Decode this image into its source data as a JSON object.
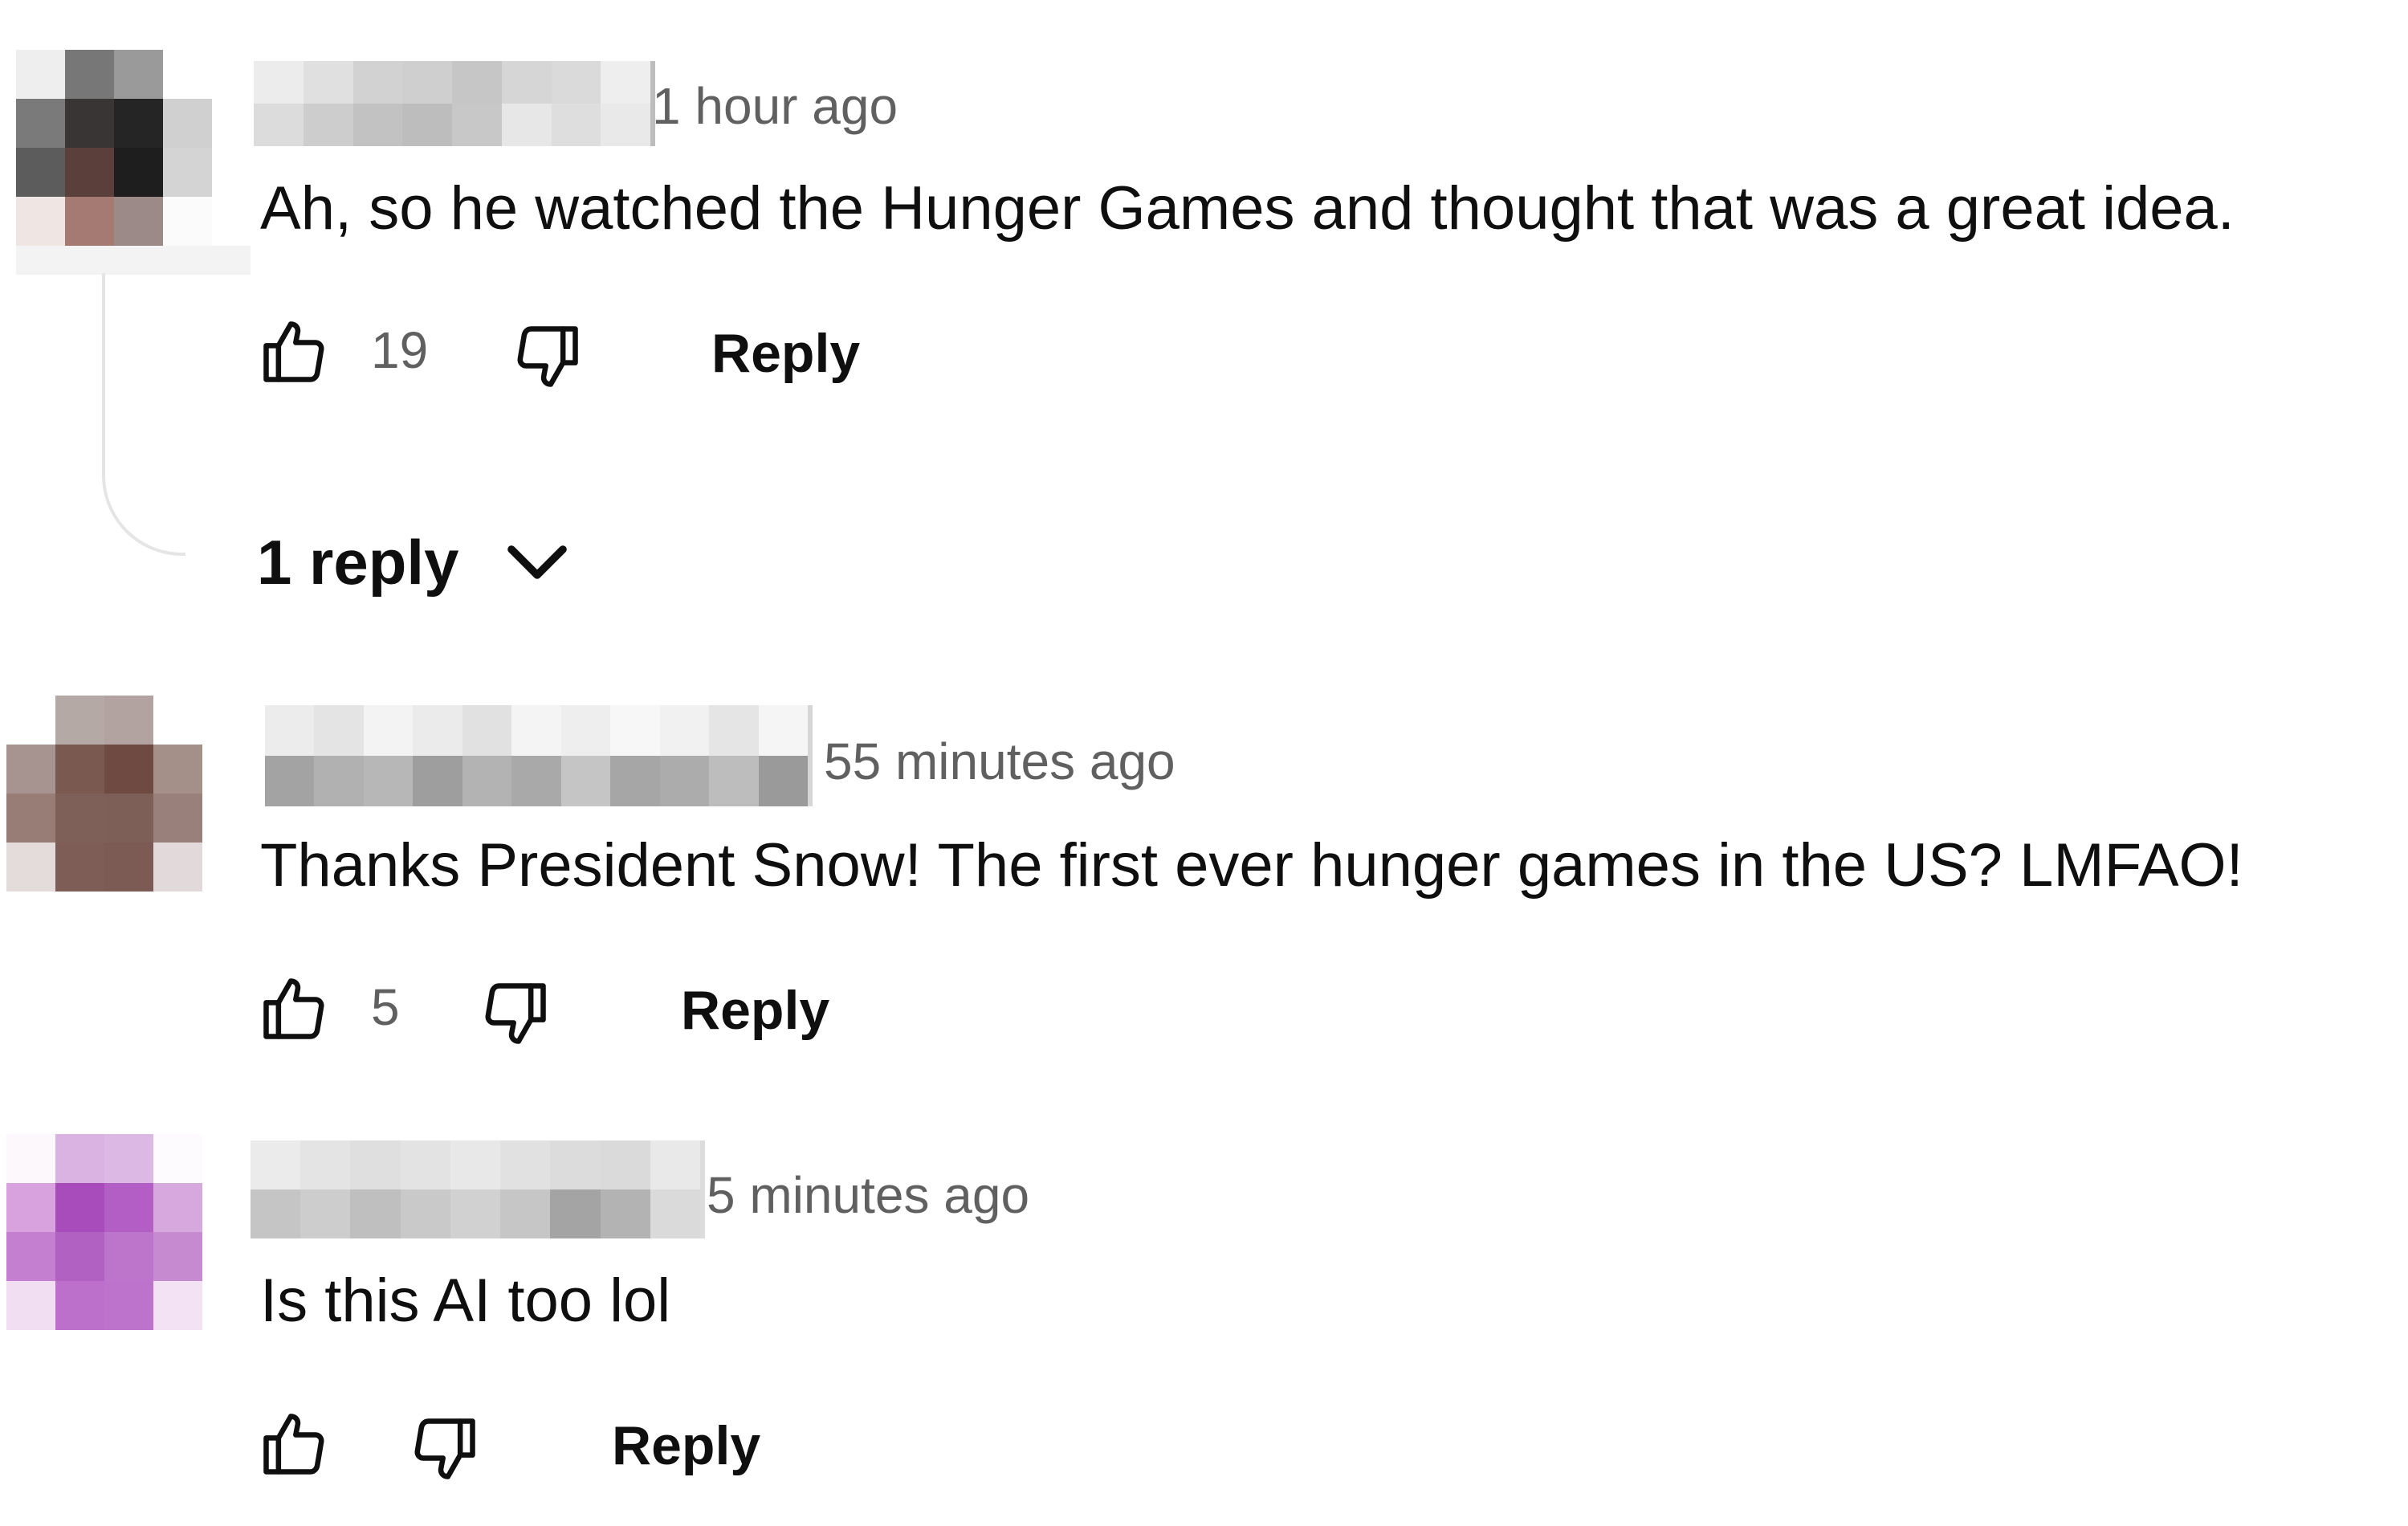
{
  "comments": [
    {
      "time": "1 hour ago",
      "text": "Ah, so he watched the Hunger Games and thought that was a great idea.",
      "likes": "19",
      "reply_label": "Reply",
      "replies_label": "1 reply"
    },
    {
      "time": "55 minutes ago",
      "text": "Thanks President Snow!  The first ever hunger games in the US?  LMFAO!",
      "likes": "5",
      "reply_label": "Reply"
    },
    {
      "time": "5 minutes ago",
      "text": "Is this AI too lol",
      "likes": "",
      "reply_label": "Reply"
    }
  ],
  "icons": {
    "like": "thumbs-up-icon",
    "dislike": "thumbs-down-icon",
    "expand": "chevron-down-icon"
  },
  "colors": {
    "text": "#0f0f0f",
    "meta": "#606060",
    "thread_line": "#e5e5e5"
  }
}
